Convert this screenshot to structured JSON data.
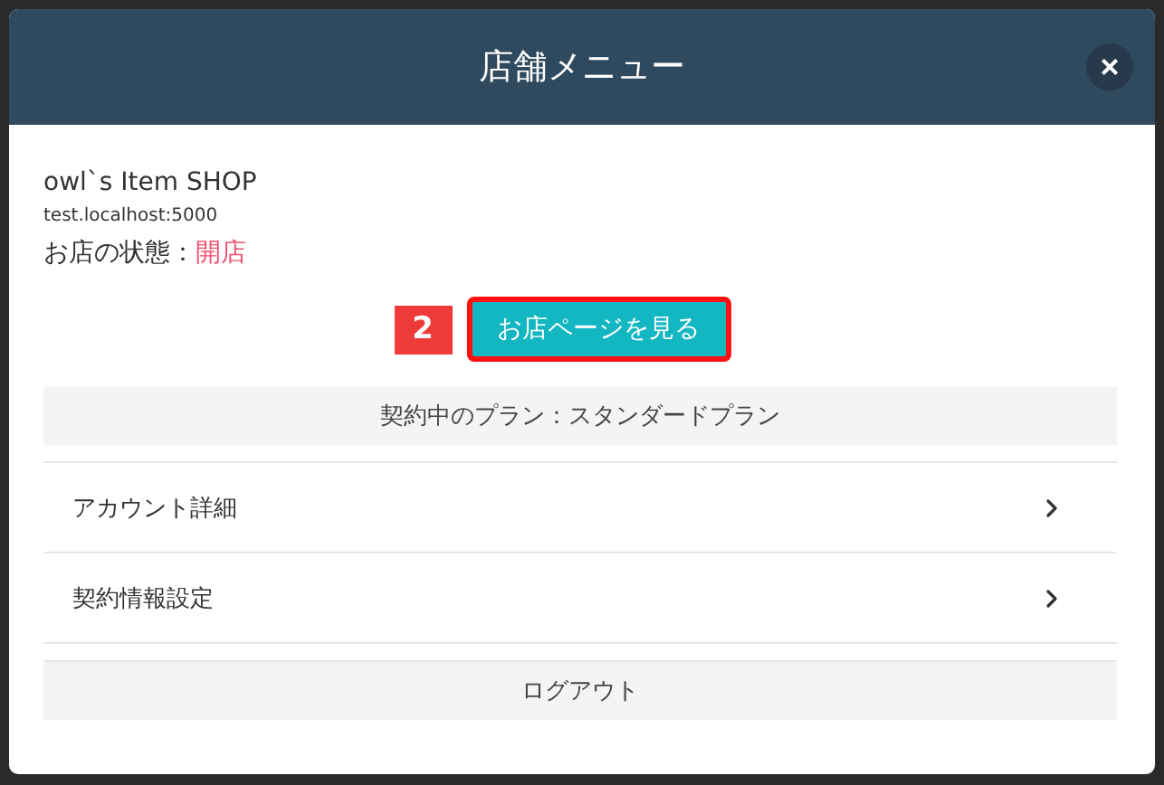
{
  "dialog": {
    "title": "店舗メニュー",
    "close": "×"
  },
  "shop": {
    "name": "owl`s Item SHOP",
    "url": "test.localhost:5000",
    "status_label": "お店の状態：",
    "status_value": "開店"
  },
  "annotation": {
    "badge": "2"
  },
  "view_button": {
    "label": "お店ページを見る",
    "highlighted": true
  },
  "plan": "契約中のプラン：スタンダードプラン",
  "menu_items": [
    {
      "label": "アカウント詳細"
    },
    {
      "label": "契約情報設定"
    }
  ],
  "logout": "ログアウト"
}
